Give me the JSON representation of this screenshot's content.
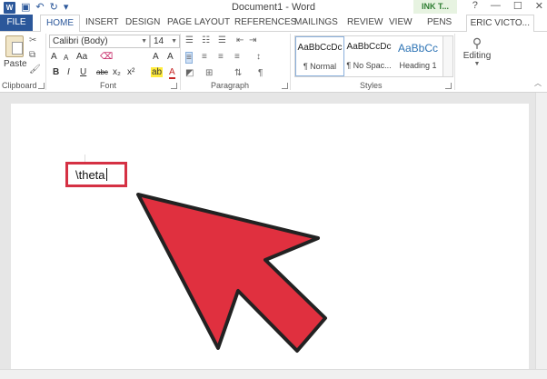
{
  "window": {
    "title": "Document1 - Word",
    "ink_tab": "INK T...",
    "controls": [
      "?",
      "—",
      "☐",
      "✕"
    ]
  },
  "qat": {
    "undo": "↶",
    "redo": "↻",
    "save": "💾"
  },
  "tabs": {
    "file": "FILE",
    "items": [
      "HOME",
      "INSERT",
      "DESIGN",
      "PAGE LAYOUT",
      "REFERENCES",
      "MAILINGS",
      "REVIEW",
      "VIEW",
      "PENS"
    ],
    "user": "ERIC VICTO..."
  },
  "ribbon": {
    "clipboard": {
      "paste_label": "Paste",
      "group_label": "Clipboard"
    },
    "font": {
      "font_name": "Calibri (Body)",
      "font_size": "14",
      "grow": "A",
      "shrink": "A",
      "aa": "Aa",
      "group_label": "Font",
      "bold": "B",
      "italic": "I",
      "underline": "U",
      "strike": "abc",
      "sub": "x₂",
      "sup": "x²",
      "text_effect": "A",
      "highlight": "ab",
      "font_color": "A"
    },
    "paragraph": {
      "group_label": "Paragraph",
      "pilcrow": "¶"
    },
    "styles": {
      "group_label": "Styles",
      "items": [
        {
          "preview": "AaBbCcDc",
          "name": "¶ Normal"
        },
        {
          "preview": "AaBbCcDc",
          "name": "¶ No Spac..."
        },
        {
          "preview": "AaBbCc",
          "name": "Heading 1"
        }
      ]
    },
    "editing": {
      "label": "Editing",
      "icon": "binoculars-icon"
    }
  },
  "document": {
    "typed_text": "\\theta"
  },
  "colors": {
    "word_blue": "#2b579a",
    "highlight_red": "#d53144",
    "arrow_red": "#e0303f"
  }
}
